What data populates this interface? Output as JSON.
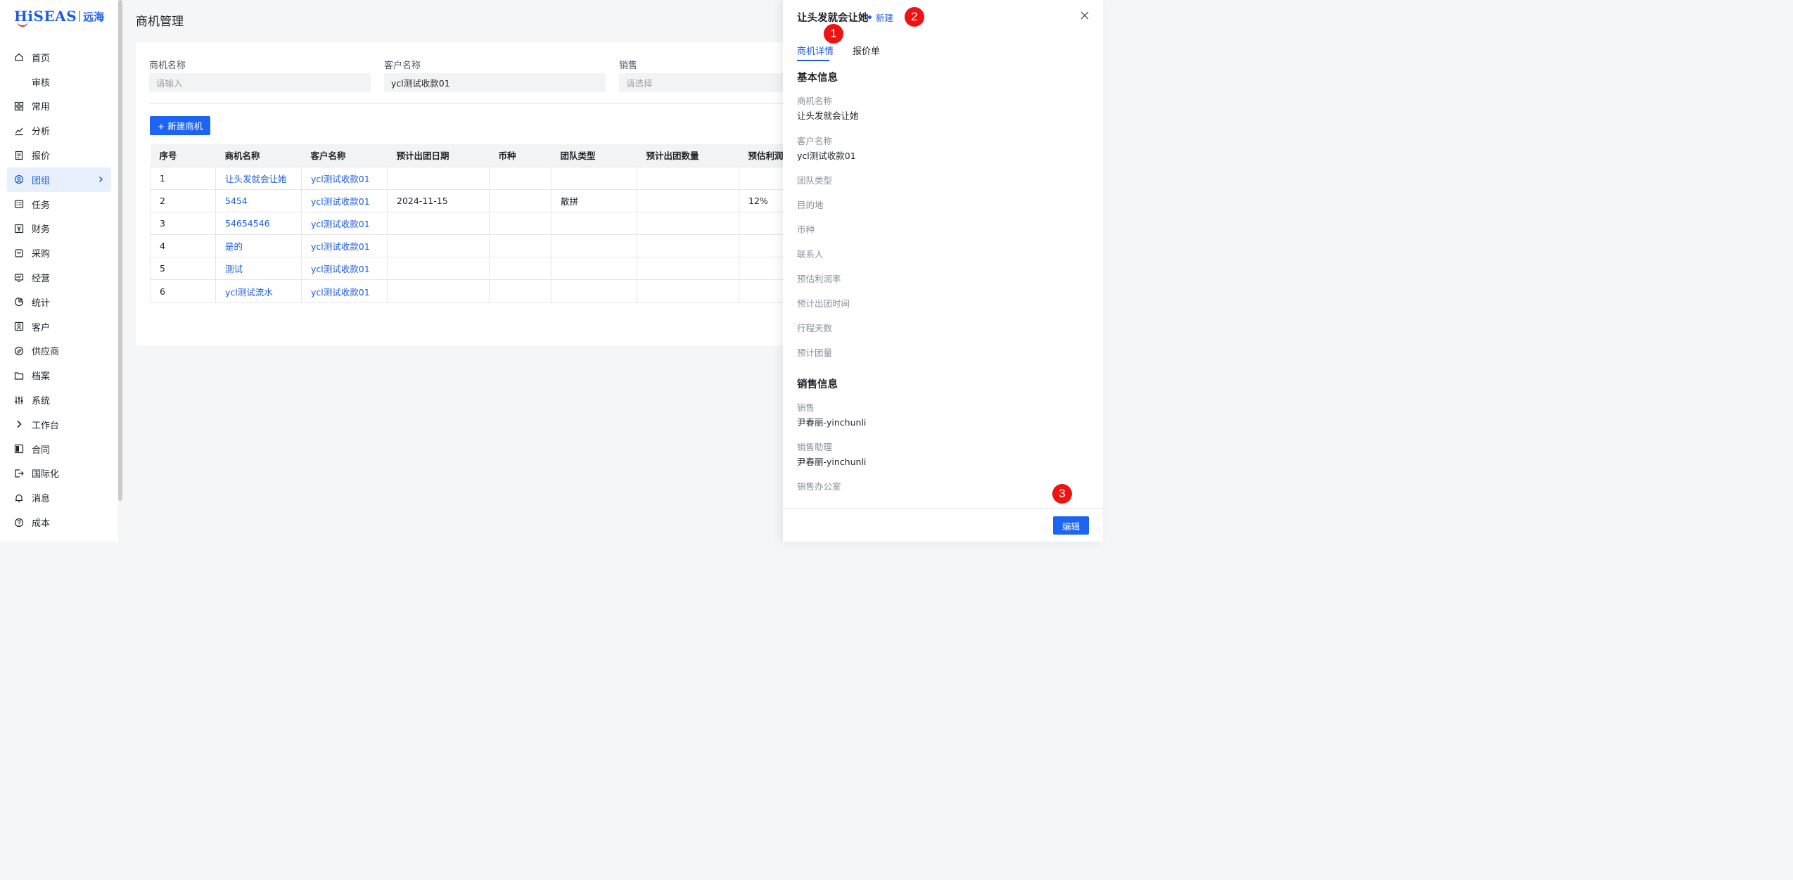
{
  "app": {
    "logo_en": "HiSEAS",
    "logo_cn": "远海"
  },
  "sidebar": {
    "items": [
      {
        "label": "首页",
        "icon": "home-icon"
      },
      {
        "label": "审核",
        "icon": ""
      },
      {
        "label": "常用",
        "icon": "grid-icon"
      },
      {
        "label": "分析",
        "icon": "chart-line-icon"
      },
      {
        "label": "报价",
        "icon": "document-icon"
      },
      {
        "label": "团组",
        "icon": "team-icon",
        "active": true
      },
      {
        "label": "任务",
        "icon": "task-icon"
      },
      {
        "label": "财务",
        "icon": "yen-icon"
      },
      {
        "label": "采购",
        "icon": "cart-icon"
      },
      {
        "label": "经营",
        "icon": "monitor-icon"
      },
      {
        "label": "统计",
        "icon": "pie-icon"
      },
      {
        "label": "客户",
        "icon": "customer-icon"
      },
      {
        "label": "供应商",
        "icon": "supplier-icon"
      },
      {
        "label": "档案",
        "icon": "folder-icon"
      },
      {
        "label": "系统",
        "icon": "sliders-icon"
      },
      {
        "label": "工作台",
        "icon": "chevron-right-icon"
      },
      {
        "label": "合同",
        "icon": "contract-icon"
      },
      {
        "label": "国际化",
        "icon": "exit-icon"
      },
      {
        "label": "消息",
        "icon": "bell-icon"
      },
      {
        "label": "成本",
        "icon": "help-circle-icon"
      }
    ]
  },
  "main": {
    "title": "商机管理",
    "filters": [
      {
        "label": "商机名称",
        "placeholder": "请输入",
        "value": ""
      },
      {
        "label": "客户名称",
        "placeholder": "",
        "value": "ycl测试收款01"
      },
      {
        "label": "销售",
        "placeholder": "请选择",
        "value": ""
      }
    ],
    "new_button": "+ 新建商机",
    "table": {
      "columns": [
        "序号",
        "商机名称",
        "客户名称",
        "预计出团日期",
        "币种",
        "团队类型",
        "预计出团数量",
        "预估利润率"
      ],
      "rows": [
        [
          "1",
          "让头发就会让她",
          "ycl测试收款01",
          "",
          "",
          "",
          "",
          ""
        ],
        [
          "2",
          "5454",
          "ycl测试收款01",
          "2024-11-15",
          "",
          "散拼",
          "",
          "12%"
        ],
        [
          "3",
          "54654546",
          "ycl测试收款01",
          "",
          "",
          "",
          "",
          ""
        ],
        [
          "4",
          "是的",
          "ycl测试收款01",
          "",
          "",
          "",
          "",
          ""
        ],
        [
          "5",
          "测试",
          "ycl测试收款01",
          "",
          "",
          "",
          "",
          ""
        ],
        [
          "6",
          "ycl测试流水",
          "ycl测试收款01",
          "",
          "",
          "",
          "",
          ""
        ]
      ]
    }
  },
  "drawer": {
    "title": "让头发就会让她",
    "status": "新建",
    "tabs": [
      "商机详情",
      "报价单"
    ],
    "basic_section": "基本信息",
    "basic_fields": [
      {
        "label": "商机名称",
        "value": "让头发就会让她"
      },
      {
        "label": "客户名称",
        "value": "ycl测试收款01"
      },
      {
        "label": "团队类型",
        "value": ""
      },
      {
        "label": "目的地",
        "value": ""
      },
      {
        "label": "币种",
        "value": ""
      },
      {
        "label": "联系人",
        "value": ""
      },
      {
        "label": "预估利润率",
        "value": ""
      },
      {
        "label": "预计出团时间",
        "value": ""
      },
      {
        "label": "行程天数",
        "value": ""
      },
      {
        "label": "预计团量",
        "value": ""
      }
    ],
    "sales_section": "销售信息",
    "sales_fields": [
      {
        "label": "销售",
        "value": "尹春丽-yinchunli"
      },
      {
        "label": "销售助理",
        "value": "尹春丽-yinchunli"
      },
      {
        "label": "销售办公室",
        "value": ""
      }
    ],
    "edit_button": "编辑"
  },
  "markers": [
    "1",
    "2",
    "3"
  ],
  "colors": {
    "accent": "#1c64f2",
    "marker": "#ee1212"
  }
}
